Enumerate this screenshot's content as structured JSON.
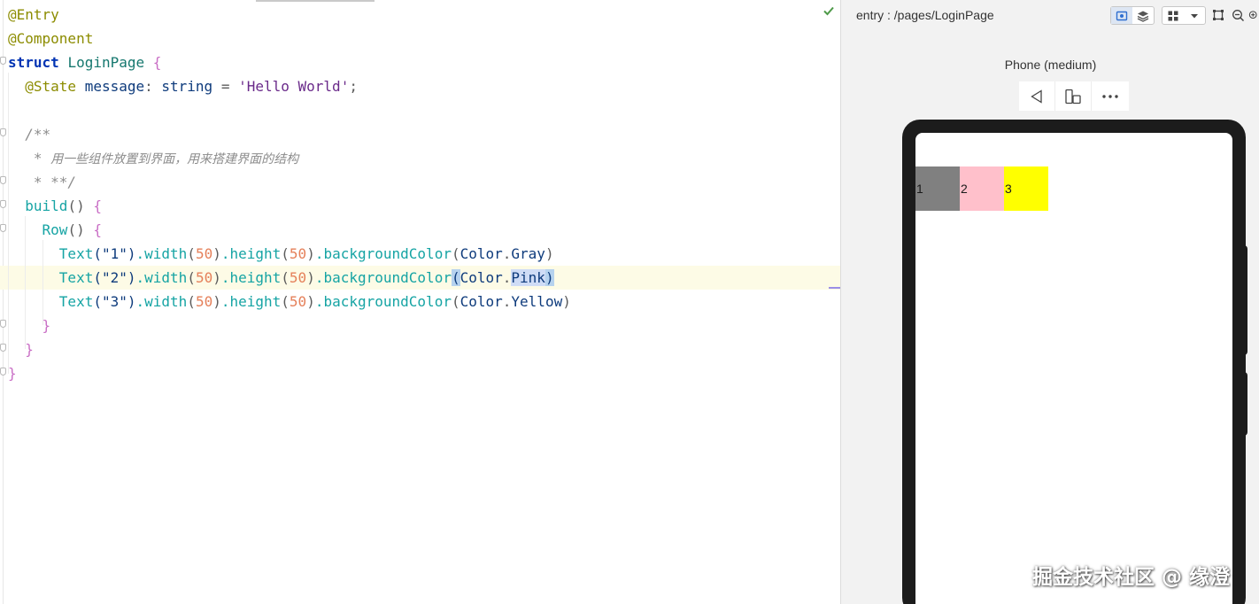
{
  "editor": {
    "lines": [
      {
        "tokens": [
          {
            "t": "@Entry",
            "c": "ann"
          }
        ]
      },
      {
        "tokens": [
          {
            "t": "@Component",
            "c": "ann"
          }
        ]
      },
      {
        "tokens": [
          {
            "t": "struct",
            "c": "kw"
          },
          {
            "t": " ",
            "c": "punc"
          },
          {
            "t": "LoginPage",
            "c": "type"
          },
          {
            "t": " {",
            "c": "brace"
          }
        ]
      },
      {
        "tokens": [
          {
            "t": "  @State",
            "c": "ann"
          },
          {
            "t": " message",
            "c": "plain"
          },
          {
            "t": ": ",
            "c": "punc"
          },
          {
            "t": "string",
            "c": "plain"
          },
          {
            "t": " = ",
            "c": "punc"
          },
          {
            "t": "'Hello World'",
            "c": "str"
          },
          {
            "t": ";",
            "c": "punc"
          }
        ]
      },
      {
        "tokens": []
      },
      {
        "tokens": [
          {
            "t": "  /**",
            "c": "cmt"
          }
        ]
      },
      {
        "tokens": [
          {
            "t": "   * ",
            "c": "cmt"
          },
          {
            "t": "用一些组件放置到界面，用来搭建界面的结构",
            "c": "cmtcn"
          }
        ]
      },
      {
        "tokens": [
          {
            "t": "   * **/",
            "c": "cmt"
          }
        ]
      },
      {
        "tokens": [
          {
            "t": "  build",
            "c": "fn"
          },
          {
            "t": "()",
            "c": "punc"
          },
          {
            "t": " {",
            "c": "brace"
          }
        ]
      },
      {
        "tokens": [
          {
            "t": "    Row",
            "c": "fn"
          },
          {
            "t": "()",
            "c": "punc"
          },
          {
            "t": " {",
            "c": "brace"
          }
        ]
      },
      {
        "tokens": [
          {
            "t": "      Text",
            "c": "fn"
          },
          {
            "t": "(\"1\")",
            "c": "plain"
          },
          {
            "t": ".width",
            "c": "fn"
          },
          {
            "t": "(",
            "c": "punc"
          },
          {
            "t": "50",
            "c": "num"
          },
          {
            "t": ")",
            "c": "punc"
          },
          {
            "t": ".height",
            "c": "fn"
          },
          {
            "t": "(",
            "c": "punc"
          },
          {
            "t": "50",
            "c": "num"
          },
          {
            "t": ")",
            "c": "punc"
          },
          {
            "t": ".backgroundColor",
            "c": "fn"
          },
          {
            "t": "(",
            "c": "punc"
          },
          {
            "t": "Color",
            "c": "plain"
          },
          {
            "t": ".",
            "c": "punc"
          },
          {
            "t": "Gray",
            "c": "plain"
          },
          {
            "t": ")",
            "c": "punc"
          }
        ]
      },
      {
        "current": true,
        "tokens": [
          {
            "t": "      Text",
            "c": "fn"
          },
          {
            "t": "(\"2\")",
            "c": "plain"
          },
          {
            "t": ".width",
            "c": "fn"
          },
          {
            "t": "(",
            "c": "punc"
          },
          {
            "t": "50",
            "c": "num"
          },
          {
            "t": ")",
            "c": "punc"
          },
          {
            "t": ".height",
            "c": "fn"
          },
          {
            "t": "(",
            "c": "punc"
          },
          {
            "t": "50",
            "c": "num"
          },
          {
            "t": ")",
            "c": "punc"
          },
          {
            "t": ".backgroundColor",
            "c": "fn"
          },
          {
            "t": "(",
            "c": "match"
          },
          {
            "t": "Color",
            "c": "plain"
          },
          {
            "t": ".",
            "c": "punc"
          },
          {
            "t": "Pink",
            "c": "sel"
          },
          {
            "t": ")",
            "c": "match"
          }
        ]
      },
      {
        "tokens": [
          {
            "t": "      Text",
            "c": "fn"
          },
          {
            "t": "(\"3\")",
            "c": "plain"
          },
          {
            "t": ".width",
            "c": "fn"
          },
          {
            "t": "(",
            "c": "punc"
          },
          {
            "t": "50",
            "c": "num"
          },
          {
            "t": ")",
            "c": "punc"
          },
          {
            "t": ".height",
            "c": "fn"
          },
          {
            "t": "(",
            "c": "punc"
          },
          {
            "t": "50",
            "c": "num"
          },
          {
            "t": ")",
            "c": "punc"
          },
          {
            "t": ".backgroundColor",
            "c": "fn"
          },
          {
            "t": "(",
            "c": "punc"
          },
          {
            "t": "Color",
            "c": "plain"
          },
          {
            "t": ".",
            "c": "punc"
          },
          {
            "t": "Yellow",
            "c": "plain"
          },
          {
            "t": ")",
            "c": "punc"
          }
        ]
      },
      {
        "tokens": [
          {
            "t": "    }",
            "c": "brace"
          }
        ]
      },
      {
        "tokens": [
          {
            "t": "  }",
            "c": "brace"
          }
        ]
      },
      {
        "tokens": [
          {
            "t": "}",
            "c": "brace"
          }
        ]
      }
    ]
  },
  "preview": {
    "route_label": "entry : /pages/LoginPage",
    "device_name": "Phone (medium)",
    "toolbar_icons": [
      "inspector-icon",
      "layers-icon",
      "grid-icon",
      "dropdown-icon",
      "crop-icon",
      "zoom-out-icon",
      "zoom-in-icon"
    ],
    "device_bar_icons": [
      "back-triangle-icon",
      "rotate-device-icon",
      "more-icon"
    ],
    "row_boxes": [
      {
        "label": "1",
        "color": "#808080"
      },
      {
        "label": "2",
        "color": "#ffc0cb"
      },
      {
        "label": "3",
        "color": "#ffff00"
      }
    ]
  },
  "watermark": "掘金技术社区 @ 缘澄"
}
